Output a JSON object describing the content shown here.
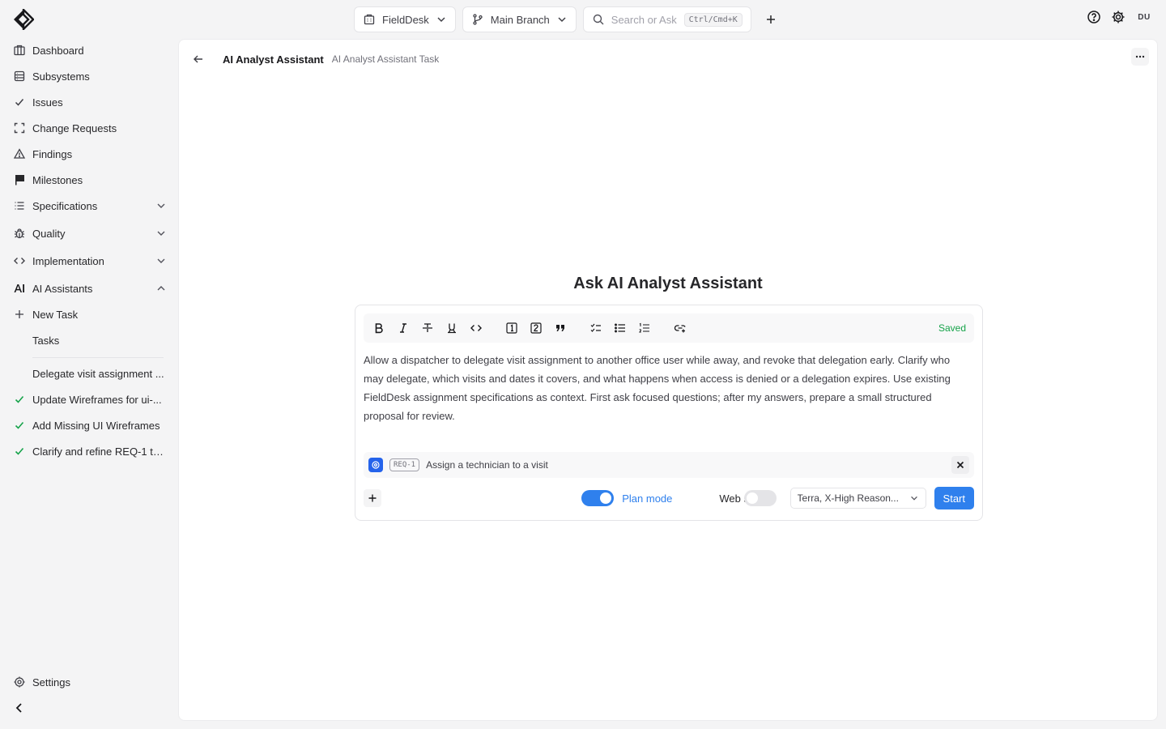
{
  "topbar": {
    "project": "FieldDesk",
    "branch": "Main Branch",
    "search_placeholder": "Search or Ask",
    "search_shortcut": "Ctrl/Cmd+K",
    "user_initials": "DU"
  },
  "sidebar": {
    "items": [
      {
        "label": "Dashboard",
        "icon": "building-icon"
      },
      {
        "label": "Subsystems",
        "icon": "database-icon"
      },
      {
        "label": "Issues",
        "icon": "check-icon"
      },
      {
        "label": "Change Requests",
        "icon": "frame-icon"
      },
      {
        "label": "Findings",
        "icon": "warning-icon"
      },
      {
        "label": "Milestones",
        "icon": "flag-icon"
      },
      {
        "label": "Specifications",
        "icon": "list-icon"
      },
      {
        "label": "Quality",
        "icon": "bug-icon"
      },
      {
        "label": "Implementation",
        "icon": "code-icon"
      },
      {
        "label": "AI Assistants",
        "icon": "ai-icon"
      },
      {
        "label": "New Task",
        "icon": "plus-icon"
      },
      {
        "label": "Tasks",
        "icon": ""
      }
    ],
    "recent_tasks": [
      {
        "label": "Delegate visit assignment ...",
        "done": false
      },
      {
        "label": "Update Wireframes for ui-...",
        "done": true
      },
      {
        "label": "Add Missing UI Wireframes",
        "done": true
      },
      {
        "label": "Clarify and refine REQ-1 te...",
        "done": true
      }
    ],
    "settings_label": "Settings"
  },
  "main": {
    "title": "AI Analyst Assistant",
    "subtitle": "AI Analyst Assistant Task",
    "ask_title": "Ask AI Analyst Assistant",
    "saved_label": "Saved",
    "prompt": "Allow a dispatcher to delegate visit assignment to another office user while away, and revoke that delegation early. Clarify who may delegate, which visits and dates it covers, and what happens when access is denied or a delegation expires. Use existing FieldDesk assignment specifications as context. First ask focused questions; after my answers, prepare a small structured proposal for review.",
    "reference": {
      "tag": "REQ-1",
      "text": "Assign a technician to a visit"
    },
    "plan_mode": {
      "label": "Plan mode",
      "on": true
    },
    "web_search": {
      "label": "Web search",
      "on": false
    },
    "model": "Terra, X-High Reason...",
    "start_label": "Start"
  },
  "colors": {
    "accent": "#2f80ed",
    "saved": "#16a34a"
  }
}
